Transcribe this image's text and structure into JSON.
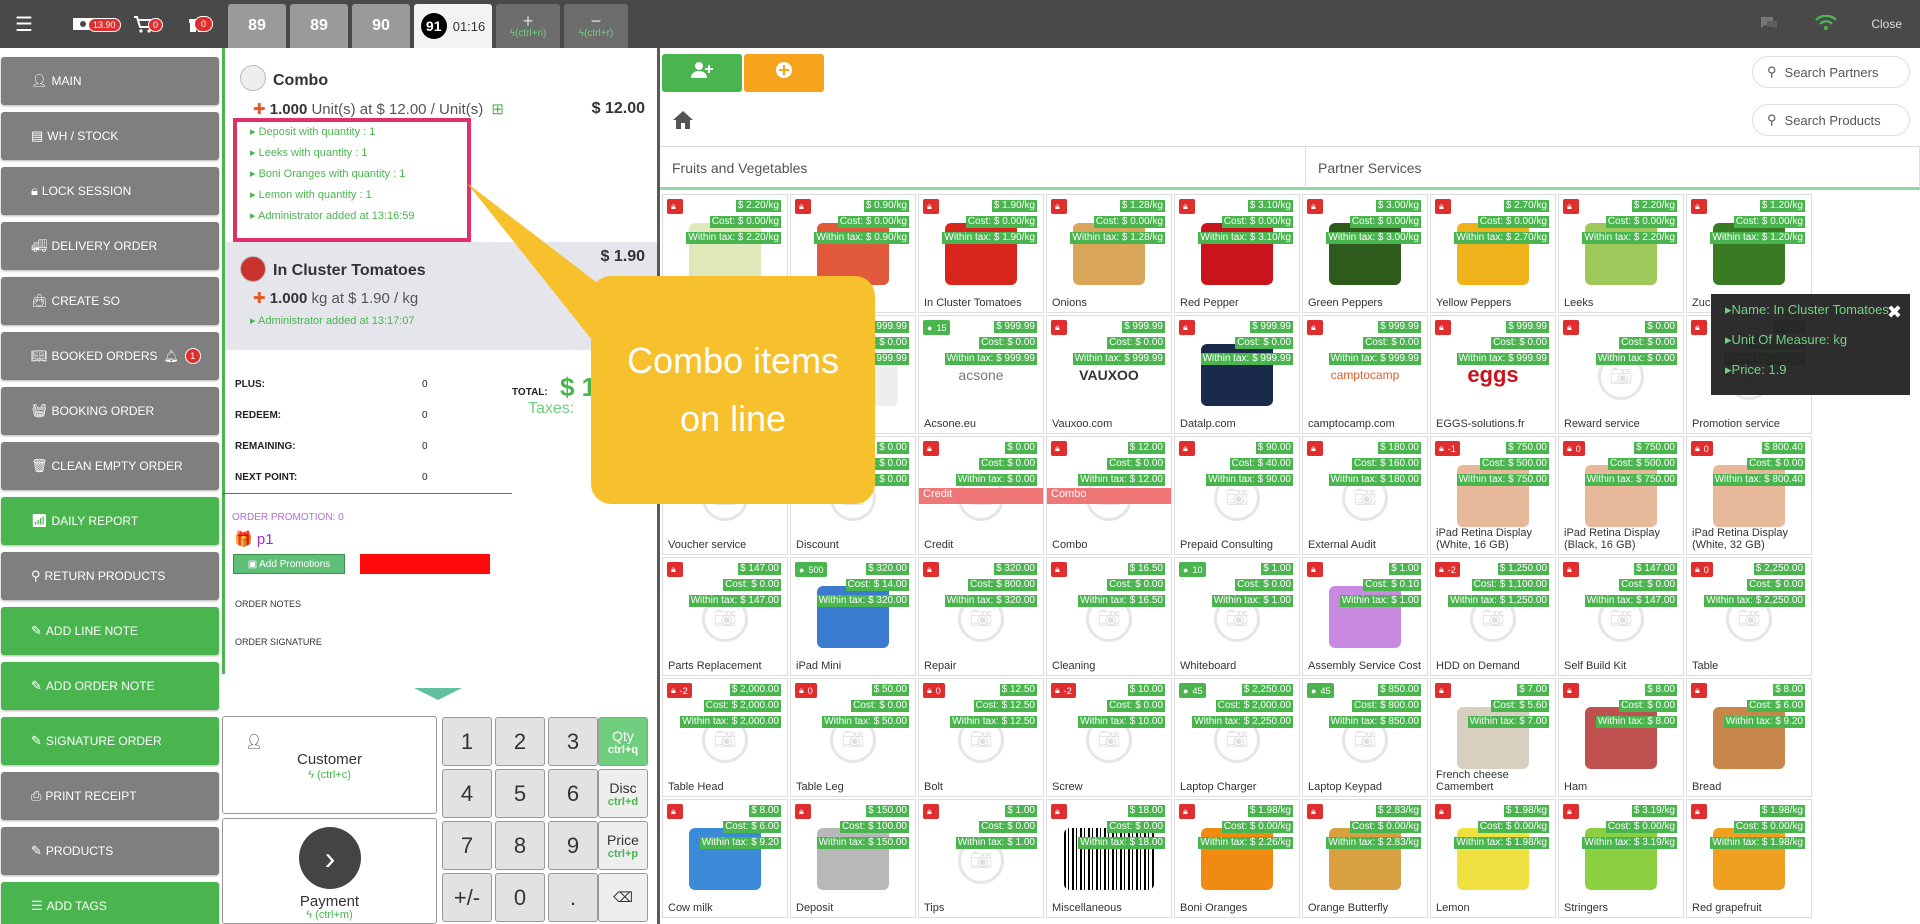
{
  "topbar": {
    "cash_badge": "13.90",
    "cart_badge": "0",
    "gift_badge": "0",
    "tabs": [
      "89",
      "89",
      "90"
    ],
    "active_tab_num": "91",
    "active_tab_time": "01:16",
    "add_shortcut": "(ctrl+n)",
    "remove_shortcut": "(ctrl+r)",
    "close_label": "Close"
  },
  "menu": [
    {
      "label": "MAIN",
      "color": "gray",
      "icon": "user-icon"
    },
    {
      "label": "WH / STOCK",
      "color": "gray",
      "icon": "warehouse-icon"
    },
    {
      "label": "LOCK SESSION",
      "color": "gray",
      "icon": "lock-icon"
    },
    {
      "label": "DELIVERY ORDER",
      "color": "gray",
      "icon": "truck-icon"
    },
    {
      "label": "CREATE SO",
      "color": "gray",
      "icon": "bag-icon"
    },
    {
      "label": "BOOKED ORDERS",
      "color": "gray",
      "icon": "book-icon",
      "badge": "1"
    },
    {
      "label": "BOOKING ORDER",
      "color": "gray",
      "icon": "basket-icon"
    },
    {
      "label": "CLEAN EMPTY ORDER",
      "color": "gray",
      "icon": "trash-icon"
    },
    {
      "label": "DAILY REPORT",
      "color": "green",
      "icon": "signal-icon"
    },
    {
      "label": "RETURN PRODUCTS",
      "color": "gray",
      "icon": "search-icon"
    },
    {
      "label": "ADD LINE NOTE",
      "color": "green",
      "icon": "edit-icon"
    },
    {
      "label": "ADD ORDER NOTE",
      "color": "green",
      "icon": "edit-icon"
    },
    {
      "label": "SIGNATURE ORDER",
      "color": "green",
      "icon": "edit-icon"
    },
    {
      "label": "PRINT RECEIPT",
      "color": "gray",
      "icon": "print-icon"
    },
    {
      "label": "PRODUCTS",
      "color": "gray",
      "icon": "edit-icon"
    },
    {
      "label": "ADD TAGS",
      "color": "green",
      "icon": "sliders-icon"
    }
  ],
  "order": {
    "line1": {
      "name": "Combo",
      "qty": "1.000",
      "qty_rest": " Unit(s) at $ 12.00 / Unit(s)",
      "price": "$ 12.00",
      "subs": [
        "Deposit with quantity : 1",
        "Leeks with quantity : 1",
        "Boni Oranges with quantity : 1",
        "Lemon with quantity : 1",
        "Administrator added at 13:16:59"
      ]
    },
    "line2": {
      "name": "In Cluster Tomatoes",
      "qty": "1.000",
      "qty_rest": " kg at $ 1.90 / kg",
      "price": "$ 1.90",
      "sub": "Administrator added at 13:17:07"
    },
    "points": [
      {
        "label": "PLUS:",
        "value": "0"
      },
      {
        "label": "REDEEM:",
        "value": "0"
      },
      {
        "label": "REMAINING:",
        "value": "0"
      },
      {
        "label": "NEXT POINT:",
        "value": "0"
      }
    ],
    "total_label": "TOTAL:",
    "total_value": "$ 1",
    "taxes_label": "Taxes:",
    "order_promotion": "ORDER PROMOTION: 0",
    "promo_name": "p1",
    "add_promotions": "Add Promotions",
    "order_notes": "ORDER NOTES",
    "order_signature": "ORDER SIGNATURE"
  },
  "actions": {
    "customer": "Customer",
    "customer_sc": "(ctrl+c)",
    "payment": "Payment",
    "payment_sc": "(ctrl+m)"
  },
  "numpad": {
    "digits": [
      "1",
      "2",
      "3",
      "4",
      "5",
      "6",
      "7",
      "8",
      "9",
      "+/-",
      "0",
      "."
    ],
    "modes": [
      {
        "label": "Qty",
        "sc": "ctrl+q"
      },
      {
        "label": "Disc",
        "sc": "ctrl+d"
      },
      {
        "label": "Price",
        "sc": "ctrl+p"
      }
    ]
  },
  "search": {
    "partners": "Search Partners",
    "products": "Search Products"
  },
  "categories": [
    "Fruits and Vegetables",
    "Partner Services"
  ],
  "tooltip": {
    "name": "Name: In Cluster Tomatoes",
    "uom": "Unit Of Measure: kg",
    "price": "Price: 1.9"
  },
  "callout": {
    "line1": "Combo items",
    "line2": "on line"
  },
  "products": [
    {
      "name": "",
      "lock": "",
      "p": [
        "$ 2.20/kg",
        "Cost: $ 0.00/kg",
        "Within tax: $ 2.20/kg"
      ],
      "img": "#dfe8b8"
    },
    {
      "name": "",
      "lock": "",
      "p": [
        "$ 0.90/kg",
        "Cost: $ 0.00/kg",
        "Within tax: $ 0.90/kg"
      ],
      "img": "#e0593a"
    },
    {
      "name": "In Cluster Tomatoes",
      "lock": "",
      "p": [
        "$ 1.90/kg",
        "Cost: $ 0.00/kg",
        "Within tax: $ 1.90/kg"
      ],
      "img": "#d9261c"
    },
    {
      "name": "Onions",
      "lock": "",
      "p": [
        "$ 1.28/kg",
        "Cost: $ 0.00/kg",
        "Within tax: $ 1.28/kg"
      ],
      "img": "#d9a65a"
    },
    {
      "name": "Red Pepper",
      "lock": "",
      "p": [
        "$ 3.10/kg",
        "Cost: $ 0.00/kg",
        "Within tax: $ 3.10/kg"
      ],
      "img": "#c8141a"
    },
    {
      "name": "Green Peppers",
      "lock": "",
      "p": [
        "$ 3.00/kg",
        "Cost: $ 0.00/kg",
        "Within tax: $ 3.00/kg"
      ],
      "img": "#2e5a1c"
    },
    {
      "name": "Yellow Peppers",
      "lock": "",
      "p": [
        "$ 2.70/kg",
        "Cost: $ 0.00/kg",
        "Within tax: $ 2.70/kg"
      ],
      "img": "#f0b21a"
    },
    {
      "name": "Leeks",
      "lock": "",
      "p": [
        "$ 2.20/kg",
        "Cost: $ 0.00/kg",
        "Within tax: $ 2.20/kg"
      ],
      "img": "#9fc85a"
    },
    {
      "name": "Zuc",
      "lock": "",
      "p": [
        "$ 1.20/kg",
        "Cost: $ 0.00/kg",
        "Within tax: $ 1.20/kg"
      ],
      "img": "#3a7a22"
    },
    {
      "name": "",
      "lock": "",
      "p": [
        "$ 999.99",
        "Cost: $ 0.00",
        "Within tax: $ 999.99"
      ],
      "img": ""
    },
    {
      "name": "",
      "lock": "",
      "p": [
        "$ 999.99",
        "Cost: $ 0.00",
        "Within tax: $ 999.99"
      ],
      "img": "#eeeeee",
      "logo": "urž"
    },
    {
      "name": "Acsone.eu",
      "lock": "15",
      "lockg": true,
      "p": [
        "$ 999.99",
        "Cost: $ 0.00",
        "Within tax: $ 999.99"
      ],
      "img": "#ffffff",
      "logo": "acsone"
    },
    {
      "name": "Vauxoo.com",
      "lock": "",
      "p": [
        "$ 999.99",
        "Cost: $ 0.00",
        "Within tax: $ 999.99"
      ],
      "img": "#ffffff",
      "logo": "VAUXOO"
    },
    {
      "name": "Datalp.com",
      "lock": "",
      "p": [
        "$ 999.99",
        "Cost: $ 0.00",
        "Within tax: $ 999.99"
      ],
      "img": "#1a2a4a"
    },
    {
      "name": "camptocamp.com",
      "lock": "",
      "p": [
        "$ 999.99",
        "Cost: $ 0.00",
        "Within tax: $ 999.99"
      ],
      "img": "#ffffff",
      "logo": "camptocamp"
    },
    {
      "name": "EGGS-solutions.fr",
      "lock": "",
      "p": [
        "$ 999.99",
        "Cost: $ 0.00",
        "Within tax: $ 999.99"
      ],
      "img": "#ffffff",
      "logo": "eggs"
    },
    {
      "name": "Reward service",
      "lock": "",
      "p": [
        "$ 0.00",
        "Cost: $ 0.00",
        "Within tax: $ 0.00"
      ],
      "img": ""
    },
    {
      "name": "Promotion service",
      "lock": "",
      "p": [
        "$ 0.00",
        "Cost: $ 0.00",
        "Within tax: $ 0.00"
      ],
      "img": ""
    },
    {
      "name": "Voucher service",
      "lock": "",
      "p": [
        "$ 0.00",
        "Cost: $ 0.00",
        "Within tax: $ 0.00"
      ],
      "img": ""
    },
    {
      "name": "Discount",
      "lock": "",
      "p": [
        "$ 0.00",
        "Cost: $ 0.00",
        "Within tax: $ 0.00"
      ],
      "img": ""
    },
    {
      "name": "Credit",
      "lock": "",
      "p": [
        "$ 0.00",
        "Cost: $ 0.00",
        "Within tax: $ 0.00"
      ],
      "img": "",
      "tag": "Credit"
    },
    {
      "name": "Combo",
      "lock": "",
      "p": [
        "$ 12.00",
        "Cost: $ 0.00",
        "Within tax: $ 12.00"
      ],
      "img": "",
      "tag": "Combo"
    },
    {
      "name": "Prepaid Consulting",
      "lock": "",
      "p": [
        "$ 90.00",
        "Cost: $ 40.00",
        "Within tax: $ 90.00"
      ],
      "img": ""
    },
    {
      "name": "External Audit",
      "lock": "",
      "p": [
        "$ 180.00",
        "Cost: $ 160.00",
        "Within tax: $ 180.00"
      ],
      "img": ""
    },
    {
      "name": "iPad Retina Display (White, 16 GB)",
      "lock": "-1",
      "p": [
        "$ 750.00",
        "Cost: $ 500.00",
        "Within tax: $ 750.00"
      ],
      "img": "#e8b89a"
    },
    {
      "name": "iPad Retina Display (Black, 16 GB)",
      "lock": "0",
      "p": [
        "$ 750.00",
        "Cost: $ 500.00",
        "Within tax: $ 750.00"
      ],
      "img": "#e8b89a"
    },
    {
      "name": "iPad Retina Display (White, 32 GB)",
      "lock": "0",
      "p": [
        "$ 800.40",
        "Cost: $ 0.00",
        "Within tax: $ 800.40"
      ],
      "img": "#e8b89a"
    },
    {
      "name": "Parts Replacement",
      "lock": "",
      "p": [
        "$ 147.00",
        "Cost: $ 0.00",
        "Within tax: $ 147.00"
      ],
      "img": ""
    },
    {
      "name": "iPad Mini",
      "lock": "500",
      "lockg": true,
      "p": [
        "$ 320.00",
        "Cost: $ 14.00",
        "Within tax: $ 320.00"
      ],
      "img": "#3a7acf"
    },
    {
      "name": "Repair",
      "lock": "",
      "p": [
        "$ 320.00",
        "Cost: $ 800.00",
        "Within tax: $ 320.00"
      ],
      "img": ""
    },
    {
      "name": "Cleaning",
      "lock": "",
      "p": [
        "$ 16.50",
        "Cost: $ 0.00",
        "Within tax: $ 16.50"
      ],
      "img": ""
    },
    {
      "name": "Whiteboard",
      "lock": "10",
      "lockg": true,
      "p": [
        "$ 1.00",
        "Cost: $ 0.00",
        "Within tax: $ 1.00"
      ],
      "img": ""
    },
    {
      "name": "Assembly Service Cost",
      "lock": "",
      "p": [
        "$ 1.00",
        "Cost: $ 0.10",
        "Within tax: $ 1.00"
      ],
      "img": "#c88ae0"
    },
    {
      "name": "HDD on Demand",
      "lock": "-2",
      "p": [
        "$ 1,250.00",
        "Cost: $ 1,100.00",
        "Within tax: $ 1,250.00"
      ],
      "img": ""
    },
    {
      "name": "Self Build Kit",
      "lock": "",
      "p": [
        "$ 147.00",
        "Cost: $ 0.00",
        "Within tax: $ 147.00"
      ],
      "img": ""
    },
    {
      "name": "Table",
      "lock": "0",
      "p": [
        "$ 2,250.00",
        "Cost: $ 0.00",
        "Within tax: $ 2,250.00"
      ],
      "img": ""
    },
    {
      "name": "Table Head",
      "lock": "-2",
      "p": [
        "$ 2,000.00",
        "Cost: $ 2,000.00",
        "Within tax: $ 2,000.00"
      ],
      "img": ""
    },
    {
      "name": "Table Leg",
      "lock": "0",
      "p": [
        "$ 50.00",
        "Cost: $ 0.00",
        "Within tax: $ 50.00"
      ],
      "img": ""
    },
    {
      "name": "Bolt",
      "lock": "0",
      "p": [
        "$ 12.50",
        "Cost: $ 12.50",
        "Within tax: $ 12.50"
      ],
      "img": ""
    },
    {
      "name": "Screw",
      "lock": "-2",
      "p": [
        "$ 10.00",
        "Cost: $ 0.00",
        "Within tax: $ 10.00"
      ],
      "img": ""
    },
    {
      "name": "Laptop Charger",
      "lock": "45",
      "lockg": true,
      "p": [
        "$ 2,250.00",
        "Cost: $ 2,000.00",
        "Within tax: $ 2,250.00"
      ],
      "img": ""
    },
    {
      "name": "Laptop Keypad",
      "lock": "45",
      "lockg": true,
      "p": [
        "$ 850.00",
        "Cost: $ 800.00",
        "Within tax: $ 850.00"
      ],
      "img": ""
    },
    {
      "name": "French cheese Camembert",
      "lock": "",
      "p": [
        "$ 7.00",
        "Cost: $ 5.60",
        "Within tax: $ 7.00"
      ],
      "img": "#d8cfc0"
    },
    {
      "name": "Ham",
      "lock": "",
      "p": [
        "$ 8.00",
        "Cost: $ 0.00",
        "Within tax: $ 8.00"
      ],
      "img": "#c05050"
    },
    {
      "name": "Bread",
      "lock": "",
      "p": [
        "$ 8.00",
        "Cost: $ 6.00",
        "Within tax: $ 9.20"
      ],
      "img": "#c8864a"
    },
    {
      "name": "Cow milk",
      "lock": "",
      "p": [
        "$ 8.00",
        "Cost: $ 6.00",
        "Within tax: $ 9.20"
      ],
      "img": "#3a8ad8"
    },
    {
      "name": "Deposit",
      "lock": "",
      "p": [
        "$ 150.00",
        "Cost: $ 100.00",
        "Within tax: $ 150.00"
      ],
      "img": "#b8b8b8"
    },
    {
      "name": "Tips",
      "lock": "",
      "p": [
        "$ 1.00",
        "Cost: $ 0.00",
        "Within tax: $ 1.00"
      ],
      "img": ""
    },
    {
      "name": "Miscellaneous",
      "lock": "",
      "p": [
        "$ 18.00",
        "Cost: $ 0.00",
        "Within tax: $ 18.00"
      ],
      "img": "#ffffff",
      "logo": "barcode"
    },
    {
      "name": "Boni Oranges",
      "lock": "",
      "p": [
        "$ 1.98/kg",
        "Cost: $ 0.00/kg",
        "Within tax: $ 2.26/kg"
      ],
      "img": "#f08a10"
    },
    {
      "name": "Orange Butterfly",
      "lock": "",
      "p": [
        "$ 2.83/kg",
        "Cost: $ 0.00/kg",
        "Within tax: $ 2.83/kg"
      ],
      "img": "#d8a040"
    },
    {
      "name": "Lemon",
      "lock": "",
      "p": [
        "$ 1.98/kg",
        "Cost: $ 0.00/kg",
        "Within tax: $ 1.98/kg"
      ],
      "img": "#f0e040"
    },
    {
      "name": "Stringers",
      "lock": "",
      "p": [
        "$ 3.19/kg",
        "Cost: $ 0.00/kg",
        "Within tax: $ 3.19/kg"
      ],
      "img": "#8ad040"
    },
    {
      "name": "Red grapefruit",
      "lock": "",
      "p": [
        "$ 1.98/kg",
        "Cost: $ 0.00/kg",
        "Within tax: $ 1.98/kg"
      ],
      "img": "#f0a020"
    }
  ]
}
